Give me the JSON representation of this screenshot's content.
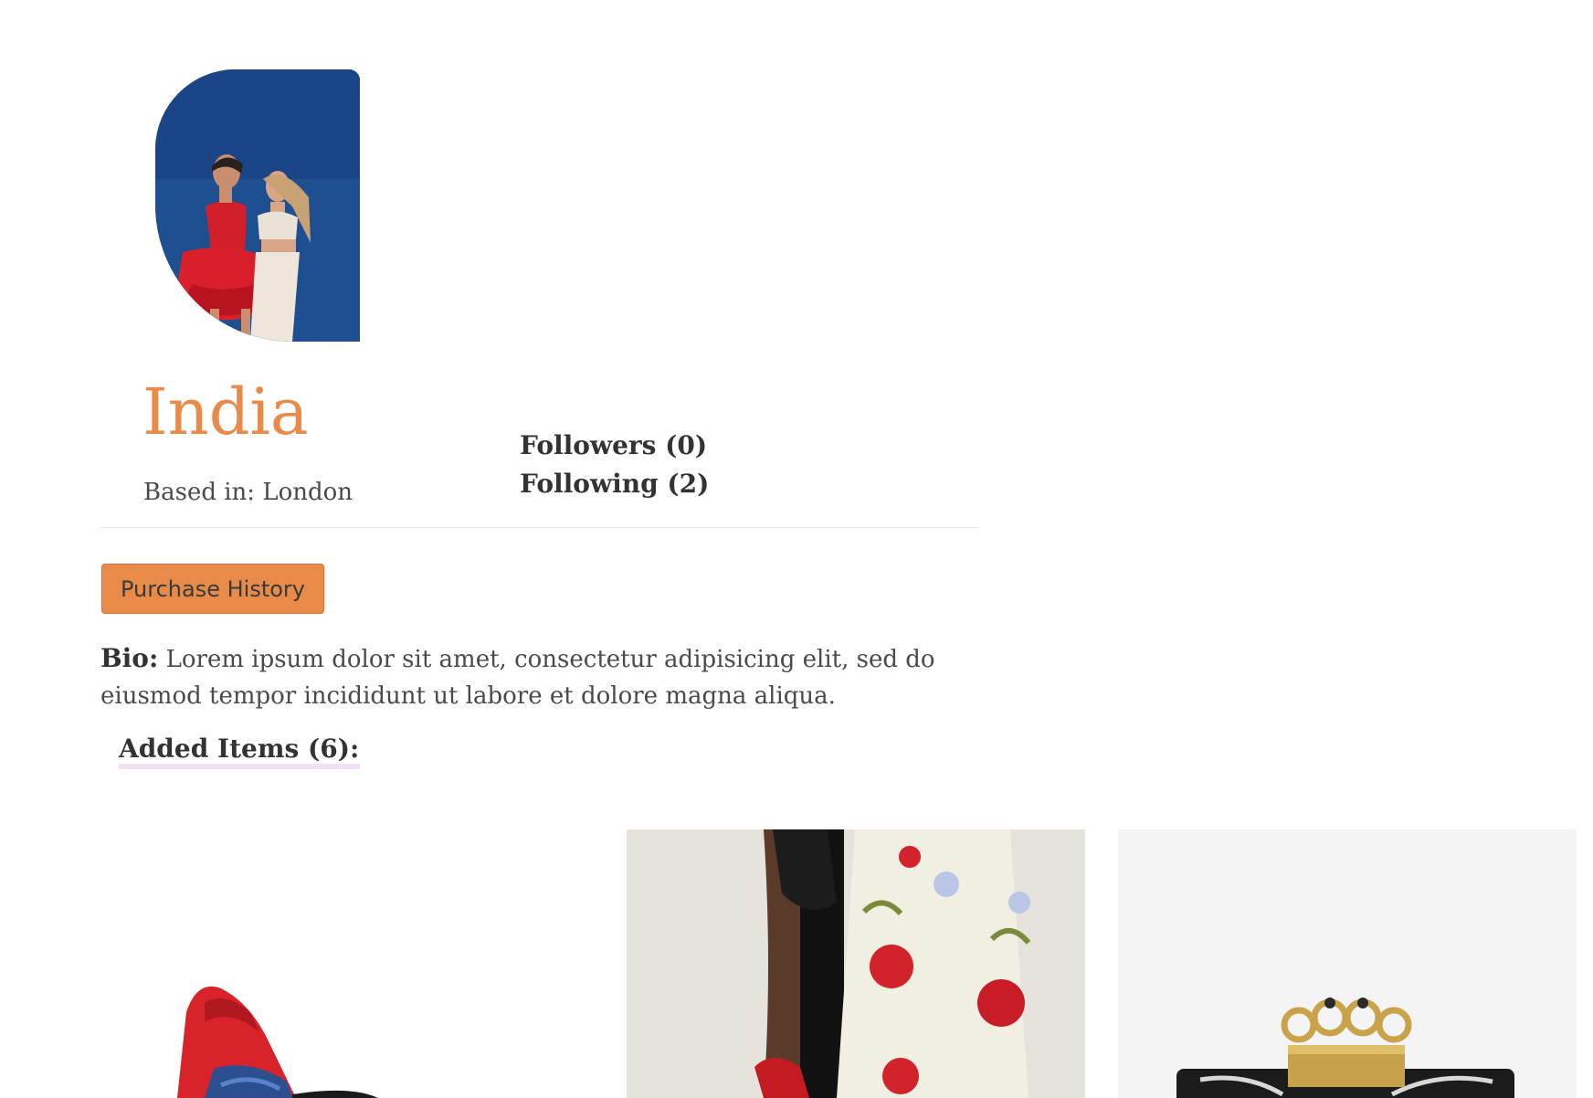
{
  "profile": {
    "name": "India",
    "based_in": "Based in: London",
    "avatar_image": "profile-photo"
  },
  "social": {
    "followers": "Followers (0)",
    "following": "Following (2)"
  },
  "actions": {
    "purchase_history": "Purchase History"
  },
  "bio": {
    "label": "Bio:",
    "text": "Lorem ipsum dolor sit amet, consectetur adipisicing elit, sed do eiusmod tempor incididunt ut labore et dolore magna aliqua."
  },
  "added_items": {
    "heading": "Added Items (6):",
    "items": [
      {
        "image": "red-heel-shoe"
      },
      {
        "image": "floral-dress-with-clutch"
      },
      {
        "image": "knuckle-clutch-bag"
      }
    ]
  },
  "colors": {
    "accent": "#e88a48",
    "heading_highlight": "#efe1f2",
    "text": "#333333"
  }
}
